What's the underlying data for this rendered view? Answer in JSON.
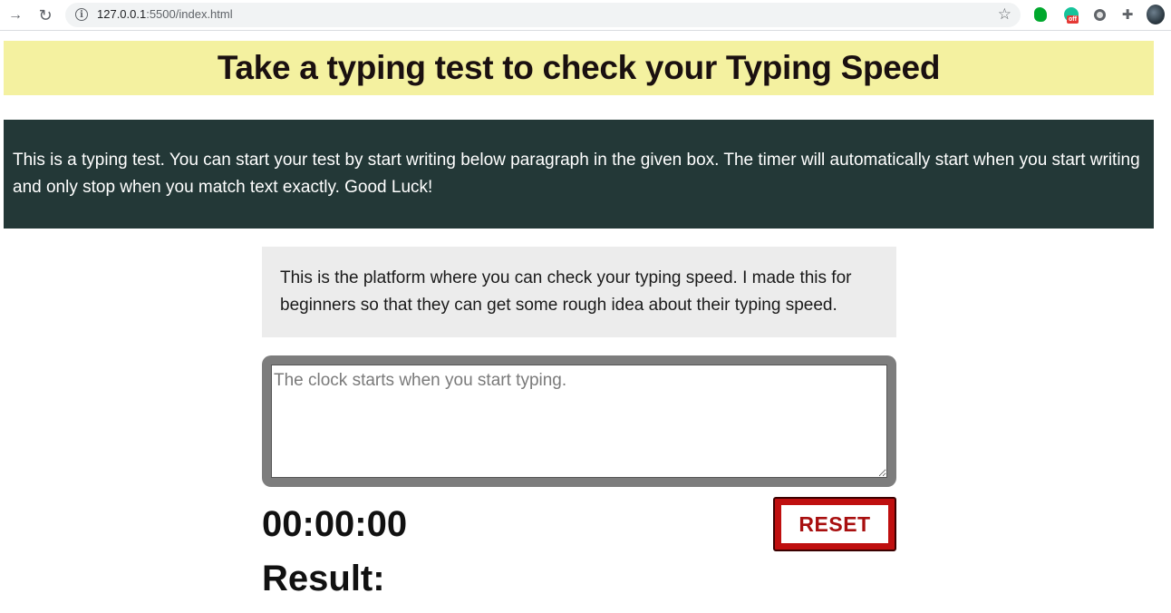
{
  "browser": {
    "url_host": "127.0.0.1",
    "url_rest": ":5500/index.html",
    "back_glyph": "→",
    "reload_glyph": "↻",
    "star_glyph": "☆",
    "puzzle_glyph": "✚",
    "grammarly_badge": "off"
  },
  "page": {
    "title": "Take a typing test to check your Typing Speed",
    "intro": "This is a typing test. You can start your test by start writing below paragraph in the given box. The timer will automatically start when you start writing and only stop when you match text exactly. Good Luck!",
    "passage": "This is the platform where you can check your typing speed. I made this for beginners so that they can get some rough idea about their typing speed.",
    "textarea_placeholder": "The clock starts when you start typing.",
    "timer": "00:00:00",
    "reset_label": "RESET",
    "result_label": "Result:"
  },
  "colors": {
    "banner_bg": "#f4f1a0",
    "intro_bg": "#233837",
    "passage_bg": "#ececec",
    "textarea_border": "#7d7d7d",
    "reset_red": "#bf0f0f"
  },
  "icons": [
    "back-icon",
    "reload-icon",
    "site-info-icon",
    "bookmark-star-icon",
    "evernote-icon",
    "grammarly-icon",
    "extension-circle-icon",
    "extensions-puzzle-icon",
    "profile-avatar-icon"
  ]
}
